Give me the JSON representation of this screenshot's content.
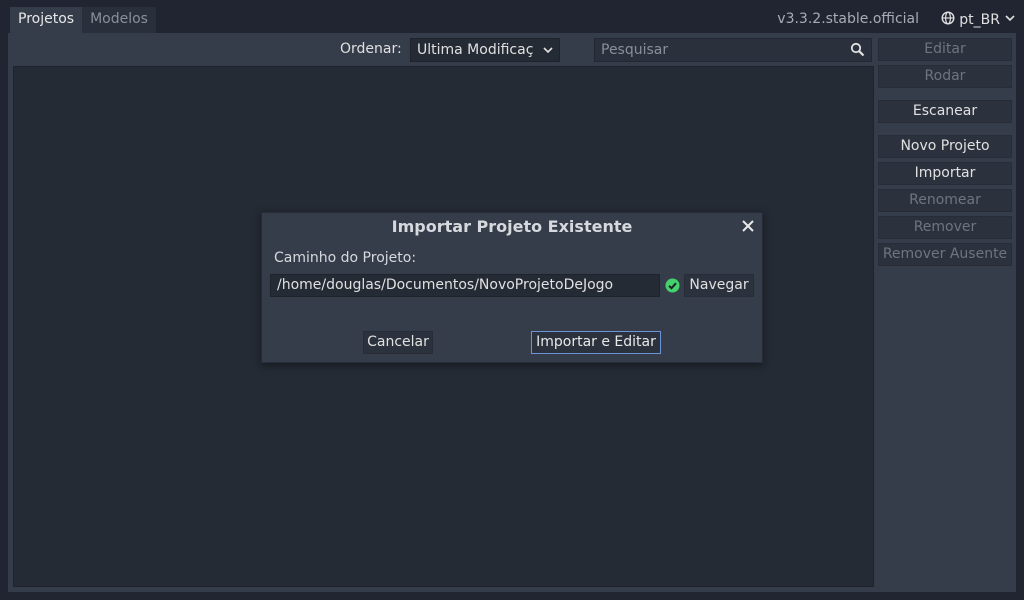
{
  "tabs": [
    {
      "label": "Projetos",
      "active": true
    },
    {
      "label": "Modelos",
      "active": false
    }
  ],
  "header": {
    "version": "v3.3.2.stable.official",
    "language": "pt_BR"
  },
  "toolbar": {
    "sort_label": "Ordenar:",
    "sort_value": "Ultima Modificaç",
    "search_placeholder": "Pesquisar"
  },
  "sidebar": {
    "buttons": [
      {
        "label": "Editar",
        "enabled": false
      },
      {
        "label": "Rodar",
        "enabled": false
      },
      {
        "label": "Escanear",
        "enabled": true
      },
      {
        "label": "Novo Projeto",
        "enabled": true
      },
      {
        "label": "Importar",
        "enabled": true
      },
      {
        "label": "Renomear",
        "enabled": false
      },
      {
        "label": "Remover",
        "enabled": false
      },
      {
        "label": "Remover Ausente",
        "enabled": false
      }
    ]
  },
  "dialog": {
    "title": "Importar Projeto Existente",
    "path_label": "Caminho do Projeto:",
    "path_value": "/home/douglas/Documentos/NovoProjetoDeJogo",
    "browse_label": "Navegar",
    "cancel_label": "Cancelar",
    "confirm_label": "Importar e Editar"
  },
  "colors": {
    "background": "#202531",
    "panel": "#363d4a",
    "field": "#252b35",
    "accent": "#6c93d6",
    "valid": "#45d16b",
    "disabled_text": "#6f757f"
  },
  "icons": {
    "language": "globe-icon",
    "language_dropdown": "chevron-down-icon",
    "sort_dropdown": "chevron-down-icon",
    "search": "search-icon",
    "close": "close-icon",
    "path_status": "check-circle-icon"
  }
}
